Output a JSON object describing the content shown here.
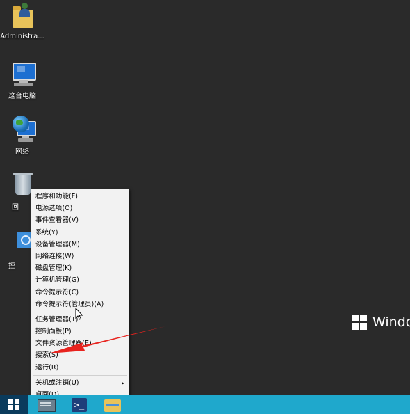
{
  "desktop": {
    "icons": [
      {
        "label": "Administra...",
        "icon": "user-folder-icon"
      },
      {
        "label": "这台电脑",
        "icon": "this-pc-icon"
      },
      {
        "label": "网络",
        "icon": "network-icon"
      },
      {
        "label": "回",
        "icon": "recycle-bin-icon"
      },
      {
        "label": "控",
        "icon": "control-panel-icon"
      }
    ],
    "watermark_text": "Windo"
  },
  "context_menu": {
    "groups": [
      [
        {
          "label": "程序和功能(F)"
        },
        {
          "label": "电源选项(O)"
        },
        {
          "label": "事件查看器(V)"
        },
        {
          "label": "系统(Y)"
        },
        {
          "label": "设备管理器(M)"
        },
        {
          "label": "网络连接(W)"
        },
        {
          "label": "磁盘管理(K)"
        },
        {
          "label": "计算机管理(G)"
        },
        {
          "label": "命令提示符(C)"
        },
        {
          "label": "命令提示符(管理员)(A)"
        }
      ],
      [
        {
          "label": "任务管理器(T)"
        },
        {
          "label": "控制面板(P)"
        },
        {
          "label": "文件资源管理器(E)"
        },
        {
          "label": "搜索(S)"
        },
        {
          "label": "运行(R)"
        }
      ],
      [
        {
          "label": "关机或注销(U)",
          "submenu_arrow": "▸"
        },
        {
          "label": "桌面(D)"
        }
      ]
    ]
  },
  "annotation": {
    "color": "#e8231e",
    "target": "搜索(S)"
  },
  "taskbar": {
    "color": "#1fa8cc",
    "start_color": "#0a3b5c",
    "powershell_glyph": ">_",
    "buttons": [
      "start-icon",
      "server-manager-icon",
      "powershell-icon",
      "file-explorer-icon"
    ]
  }
}
